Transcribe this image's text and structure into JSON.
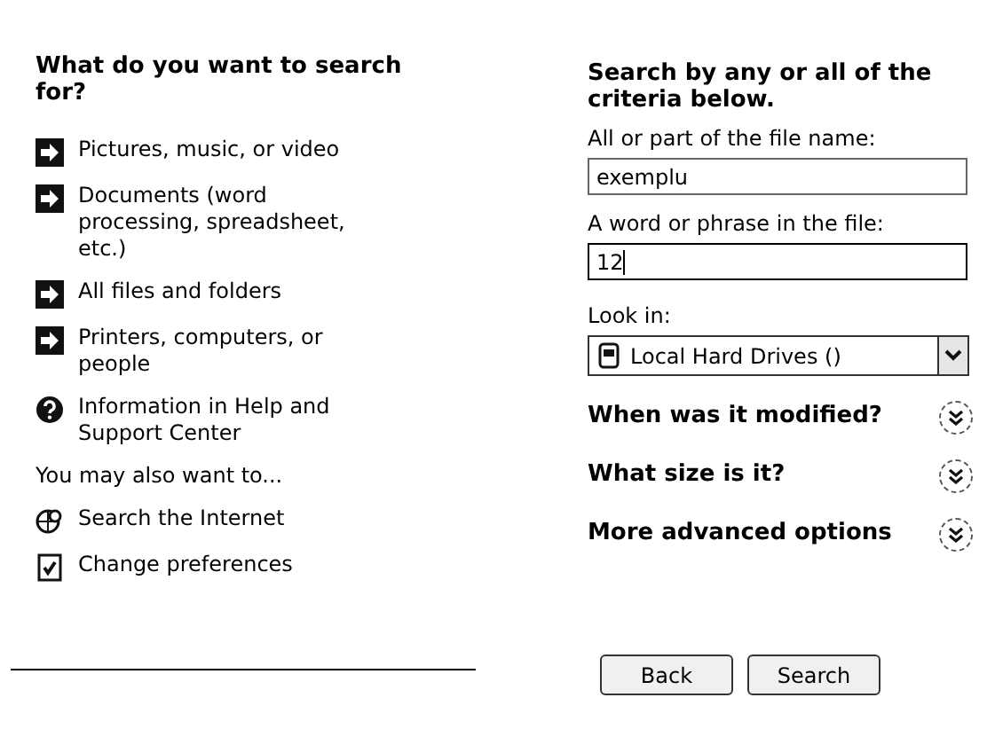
{
  "left_panel": {
    "title": "What do you want to search for?",
    "options": [
      {
        "kind": "arrow",
        "label": "Pictures, music, or video"
      },
      {
        "kind": "arrow",
        "label": "Documents (word processing, spreadsheet, etc.)"
      },
      {
        "kind": "arrow",
        "label": "All files and folders"
      },
      {
        "kind": "arrow",
        "label": "Printers, computers, or people"
      },
      {
        "kind": "help",
        "label": "Information in Help and Support Center"
      }
    ],
    "also_label": "You may also want to...",
    "also_options": [
      {
        "kind": "internet",
        "label": "Search the Internet"
      },
      {
        "kind": "preferences",
        "label": "Change preferences"
      }
    ]
  },
  "right_panel": {
    "title": "Search by any or all of the criteria below.",
    "fields": [
      {
        "label": "All or part of the file name:",
        "value": "exemplu",
        "focused": false
      },
      {
        "label": "A word or phrase in the file:",
        "value": "12",
        "focused": true
      }
    ],
    "look_in": {
      "label": "Look in:",
      "value": "Local Hard Drives ()"
    },
    "sections": [
      {
        "label": "When was it modified?",
        "expanded": false
      },
      {
        "label": "What size is it?",
        "expanded": false
      },
      {
        "label": "More advanced options",
        "expanded": false
      }
    ],
    "buttons": [
      "Back",
      "Search"
    ]
  }
}
